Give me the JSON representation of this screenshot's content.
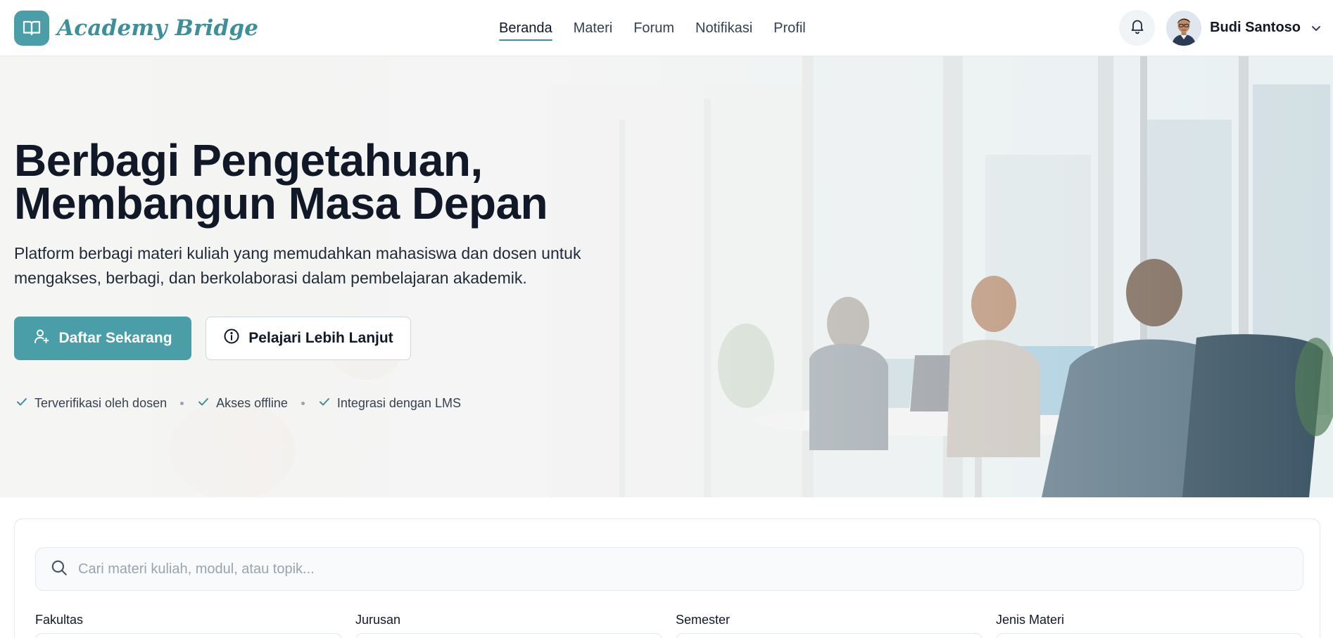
{
  "brand": {
    "name": "Academy Bridge",
    "icon": "open-book-icon",
    "color": "#4a9ea8"
  },
  "nav": {
    "items": [
      {
        "label": "Beranda",
        "active": true
      },
      {
        "label": "Materi",
        "active": false
      },
      {
        "label": "Forum",
        "active": false
      },
      {
        "label": "Notifikasi",
        "active": false
      },
      {
        "label": "Profil",
        "active": false
      }
    ]
  },
  "user": {
    "name": "Budi Santoso",
    "notification_icon": "bell-icon",
    "menu_icon": "chevron-down-icon"
  },
  "hero": {
    "title_line1": "Berbagi Pengetahuan,",
    "title_line2": "Membangun Masa Depan",
    "subtitle": "Platform berbagi materi kuliah yang memudahkan mahasiswa dan dosen untuk mengakses, berbagi, dan berkolaborasi dalam pembelajaran akademik.",
    "primary_button": {
      "label": "Daftar Sekarang",
      "icon": "user-plus-icon"
    },
    "secondary_button": {
      "label": "Pelajari Lebih Lanjut",
      "icon": "info-icon"
    },
    "features": [
      {
        "label": "Terverifikasi oleh dosen",
        "icon": "check-icon"
      },
      {
        "label": "Akses offline",
        "icon": "check-icon"
      },
      {
        "label": "Integrasi dengan LMS",
        "icon": "check-icon"
      }
    ]
  },
  "search": {
    "placeholder": "Cari materi kuliah, modul, atau topik...",
    "value": "",
    "icon": "search-icon"
  },
  "filters": [
    {
      "label": "Fakultas"
    },
    {
      "label": "Jurusan"
    },
    {
      "label": "Semester"
    },
    {
      "label": "Jenis Materi"
    }
  ],
  "colors": {
    "accent": "#4a9ea8",
    "text_dark": "#111827",
    "check": "#3d8f99"
  }
}
